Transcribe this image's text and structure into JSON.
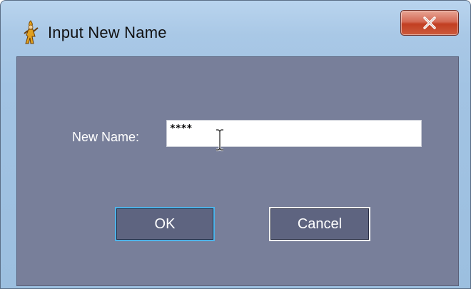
{
  "window": {
    "title": "Input New Name",
    "close_symbol": "X"
  },
  "form": {
    "name_label": "New Name:",
    "name_value": "****"
  },
  "buttons": {
    "ok_label": "OK",
    "cancel_label": "Cancel"
  },
  "icons": {
    "app": "wizard-figure-icon",
    "close": "close-icon",
    "cursor": "text-cursor-icon"
  },
  "colors": {
    "title_bar": "#a2c3e3",
    "dialog_body": "#787f9a",
    "button_fill": "#5e6480",
    "focus_border": "#4fb3e8",
    "close_button": "#c23f22"
  }
}
